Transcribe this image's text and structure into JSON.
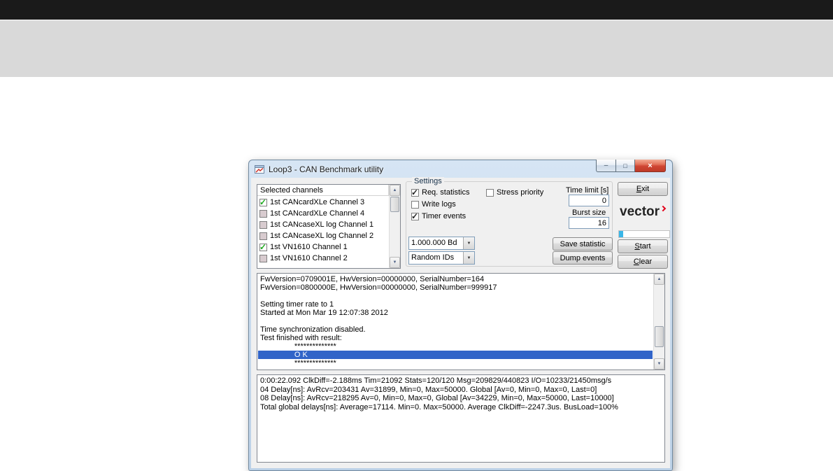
{
  "window": {
    "title": "Loop3 - CAN Benchmark utility",
    "controls": {
      "minimize": "–",
      "maximize": "□",
      "close": "×"
    }
  },
  "channels": {
    "header": "Selected channels",
    "items": [
      {
        "label": "1st CANcardXLe Channel 3",
        "checked": true
      },
      {
        "label": "1st CANcardXLe Channel 4",
        "checked": false
      },
      {
        "label": "1st CANcaseXL log Channel 1",
        "checked": false
      },
      {
        "label": "1st CANcaseXL log Channel 2",
        "checked": false
      },
      {
        "label": "1st VN1610 Channel 1",
        "checked": true
      },
      {
        "label": "1st VN1610 Channel 2",
        "checked": false
      }
    ]
  },
  "settings": {
    "title": "Settings",
    "checkboxes": [
      {
        "label": "Req. statistics",
        "checked": true
      },
      {
        "label": "Write logs",
        "checked": false
      },
      {
        "label": "Timer events",
        "checked": true
      },
      {
        "label": "Stress priority",
        "checked": false
      }
    ],
    "time_limit": {
      "label": "Time limit [s]",
      "value": "0"
    },
    "burst_size": {
      "label": "Burst size",
      "value": "16"
    },
    "baud_combo": "1.000.000 Bd",
    "id_combo": "Random IDs",
    "save_statistic_button": "Save statistic",
    "dump_events_button": "Dump events"
  },
  "side": {
    "exit_button": "Exit",
    "start_button": "Start",
    "clear_button": "Clear",
    "logo_text": "vector"
  },
  "log": {
    "lines": [
      {
        "text": "FwVersion=0709001E, HwVersion=00000000, SerialNumber=164",
        "highlight": false
      },
      {
        "text": "FwVersion=0800000E, HwVersion=00000000, SerialNumber=999917",
        "highlight": false
      },
      {
        "text": "",
        "highlight": false
      },
      {
        "text": "Setting timer rate to 1",
        "highlight": false
      },
      {
        "text": "Started at Mon Mar 19 12:07:38 2012",
        "highlight": false
      },
      {
        "text": "",
        "highlight": false
      },
      {
        "text": "Time synchronization disabled.",
        "highlight": false
      },
      {
        "text": "Test finished with result:",
        "highlight": false
      },
      {
        "text": "                **************",
        "highlight": false
      },
      {
        "text": "                O K",
        "highlight": true
      },
      {
        "text": "                **************",
        "highlight": false
      }
    ]
  },
  "stats": {
    "lines": [
      "0:00:22.092 ClkDiff=-2.188ms Tim=21092 Stats=120/120 Msg=209829/440823 I/O=10233/21450msg/s",
      "04 Delay[ns]: AvRcv=203431 Av=31899, Min=0, Max=50000. Global [Av=0, Min=0, Max=0, Last=0]",
      "08 Delay[ns]: AvRcv=218295 Av=0, Min=0, Max=0, Global [Av=34229, Min=0, Max=50000, Last=10000]",
      "Total global delays[ns]: Average=17114. Min=0. Max=50000. Average ClkDiff=-2247.3us. BusLoad=100%"
    ]
  },
  "colors": {
    "selection_blue": "#3164c8",
    "check_green": "#1faa1f",
    "vector_red": "#e2001a",
    "progress_blue": "#3ab6e8"
  },
  "icons": {
    "dropdown_arrow": "▼",
    "scroll_up": "▲",
    "scroll_down": "▼"
  }
}
